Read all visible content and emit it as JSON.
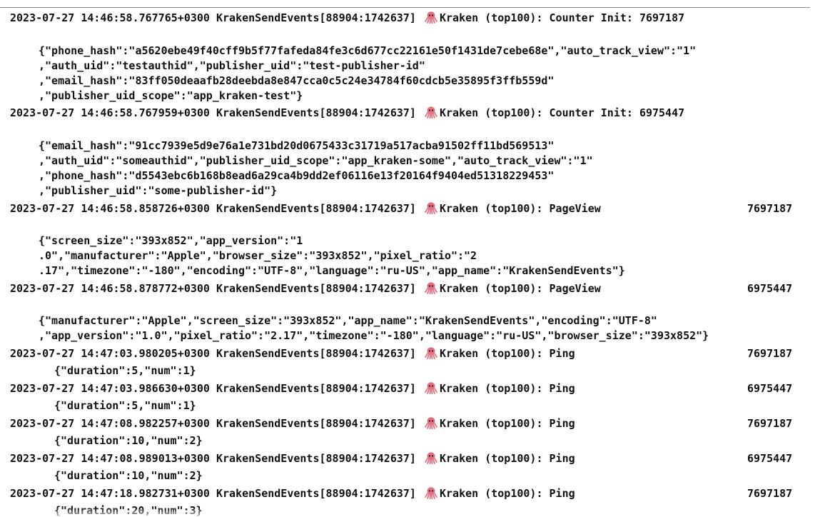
{
  "log": {
    "entries": [
      {
        "prefix": "2023-07-27 14:46:58.767765+0300 KrakenSendEvents[88904:1742637]",
        "message": "Kraken (top100): Counter Init: 7697187",
        "json_lines": [
          "{\"phone_hash\":\"a5620ebe49f40cff9b5f77fafeda84fe3c6d677cc22161e50f1431de7cebe68e\",\"auto_track_view\":\"1\"",
          ",\"auth_uid\":\"testauthid\",\"publisher_uid\":\"test-publisher-id\"",
          ",\"email_hash\":\"83ff050deaafb28deebda8e847cca0c5c24e34784f60cdcb5e35895f3ffb559d\"",
          ",\"publisher_uid_scope\":\"app_kraken-test\"}"
        ]
      },
      {
        "prefix": "2023-07-27 14:46:58.767959+0300 KrakenSendEvents[88904:1742637]",
        "message": "Kraken (top100): Counter Init: 6975447",
        "json_lines": [
          "{\"email_hash\":\"91cc7939e5d9e76a1e731bd20d0675433c31719a517acba91502ff11bd569513\"",
          ",\"auth_uid\":\"someauthid\",\"publisher_uid_scope\":\"app_kraken-some\",\"auto_track_view\":\"1\"",
          ",\"phone_hash\":\"d5543ebc6b168b8ead6a29ca4b9dd2ef06116e13f20164f9404ed51318229453\"",
          ",\"publisher_uid\":\"some-publisher-id\"}"
        ]
      },
      {
        "prefix": "2023-07-27 14:46:58.858726+0300 KrakenSendEvents[88904:1742637]",
        "message": "Kraken (top100): PageView",
        "count": "7697187",
        "json_lines": [
          "{\"screen_size\":\"393x852\",\"app_version\":\"1",
          ".0\",\"manufacturer\":\"Apple\",\"browser_size\":\"393x852\",\"pixel_ratio\":\"2",
          ".17\",\"timezone\":\"-180\",\"encoding\":\"UTF-8\",\"language\":\"ru-US\",\"app_name\":\"KrakenSendEvents\"}"
        ]
      },
      {
        "prefix": "2023-07-27 14:46:58.878772+0300 KrakenSendEvents[88904:1742637]",
        "message": "Kraken (top100): PageView",
        "count": "6975447",
        "json_lines": [
          "{\"manufacturer\":\"Apple\",\"screen_size\":\"393x852\",\"app_name\":\"KrakenSendEvents\",\"encoding\":\"UTF-8\"",
          ",\"app_version\":\"1.0\",\"pixel_ratio\":\"2.17\",\"timezone\":\"-180\",\"language\":\"ru-US\",\"browser_size\":\"393x852\"}"
        ]
      },
      {
        "prefix": "2023-07-27 14:47:03.980205+0300 KrakenSendEvents[88904:1742637]",
        "message": "Kraken (top100): Ping",
        "count": "7697187",
        "json_lines": [
          "{\"duration\":5,\"num\":1}"
        ]
      },
      {
        "prefix": "2023-07-27 14:47:03.986630+0300 KrakenSendEvents[88904:1742637]",
        "message": "Kraken (top100): Ping",
        "count": "6975447",
        "json_lines": [
          "{\"duration\":5,\"num\":1}"
        ]
      },
      {
        "prefix": "2023-07-27 14:47:08.982257+0300 KrakenSendEvents[88904:1742637]",
        "message": "Kraken (top100): Ping",
        "count": "7697187",
        "json_lines": [
          "{\"duration\":10,\"num\":2}"
        ]
      },
      {
        "prefix": "2023-07-27 14:47:08.989013+0300 KrakenSendEvents[88904:1742637]",
        "message": "Kraken (top100): Ping",
        "count": "6975447",
        "json_lines": [
          "{\"duration\":10,\"num\":2}"
        ]
      },
      {
        "prefix": "2023-07-27 14:47:18.982731+0300 KrakenSendEvents[88904:1742637]",
        "message": "Kraken (top100): Ping",
        "count": "7697187",
        "json_lines": [
          "{\"duration\":20,\"num\":3}"
        ]
      }
    ],
    "icon": "octopus-icon",
    "colors": {
      "text": "#111111",
      "octopus": "#e3707f"
    }
  }
}
